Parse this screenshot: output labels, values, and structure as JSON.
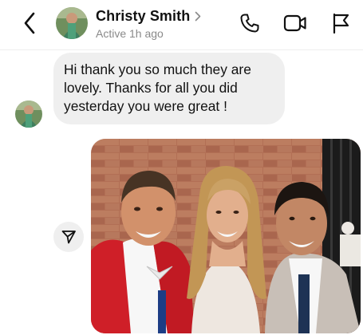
{
  "header": {
    "contact_name": "Christy Smith",
    "status": "Active 1h ago",
    "icons": {
      "back": "chevron-left-icon",
      "profile": "chevron-right-icon",
      "call": "phone-icon",
      "video": "video-camera-icon",
      "report": "flag-icon"
    }
  },
  "messages": [
    {
      "sender": "contact",
      "type": "text",
      "text": "Hi thank you so much they are lovely. Thanks for all you did yesterday you were great !"
    },
    {
      "sender": "self",
      "type": "photo",
      "description_icon": "photo-image"
    }
  ],
  "actions": {
    "share_icon": "paper-plane-icon"
  },
  "colors": {
    "bubble_bg": "#efefef",
    "status_text": "#8a8a8a",
    "text": "#111111"
  }
}
